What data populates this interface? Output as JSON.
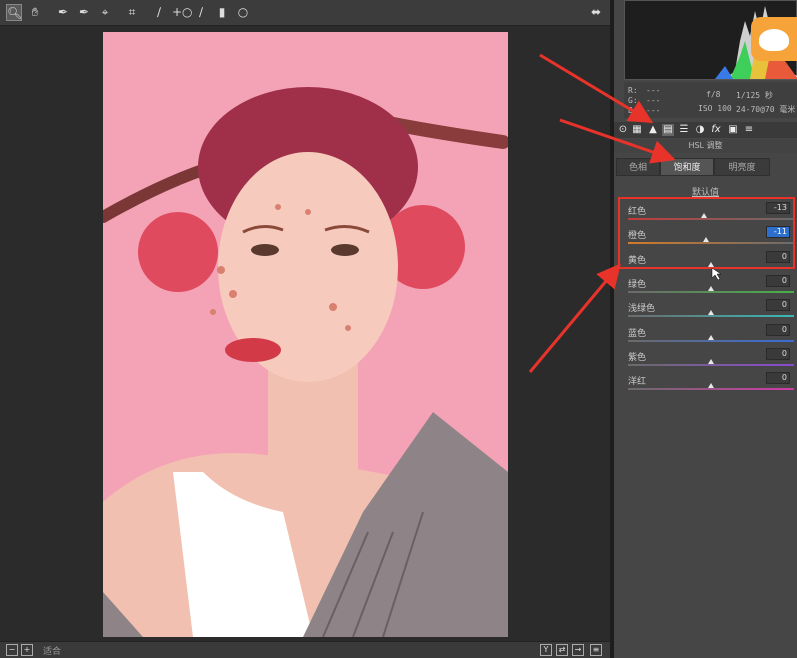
{
  "toolbar": {
    "tools": [
      "zoom-icon",
      "hand-icon",
      "eyedropper-icon",
      "color-sampler-icon",
      "target-adjust-icon",
      "crop-icon",
      "straighten-icon",
      "red-eye-icon",
      "brush-icon",
      "gradient-icon",
      "radial-icon"
    ],
    "export_icon": "export-icon"
  },
  "camera_info": {
    "r_label": "R:",
    "g_label": "G:",
    "b_label": "B:",
    "r_value": "---",
    "g_value": "---",
    "b_value": "---",
    "aperture": "f/8",
    "shutter": "1/125 秒",
    "iso": "ISO 100",
    "lens": "24-70@70 毫米"
  },
  "panel": {
    "title": "HSL 调整",
    "tabs": [
      "色相",
      "饱和度",
      "明亮度"
    ],
    "active_tab": 1,
    "default_link": "默认值",
    "sliders": [
      {
        "label": "红色",
        "value": "-13",
        "position": 0.46,
        "color_from": "#c23b3b",
        "color_to": "#6b6b6b"
      },
      {
        "label": "橙色",
        "value": "-11",
        "position": 0.47,
        "color_from": "#d27a2a",
        "color_to": "#6b6b6b"
      },
      {
        "label": "黄色",
        "value": "0",
        "position": 0.5,
        "color_from": "#6b6b6b",
        "color_to": "#d8c83a"
      },
      {
        "label": "绿色",
        "value": "0",
        "position": 0.5,
        "color_from": "#6b6b6b",
        "color_to": "#48b048"
      },
      {
        "label": "浅绿色",
        "value": "0",
        "position": 0.5,
        "color_from": "#6b6b6b",
        "color_to": "#3ab8b8"
      },
      {
        "label": "蓝色",
        "value": "0",
        "position": 0.5,
        "color_from": "#6b6b6b",
        "color_to": "#3a6bd8"
      },
      {
        "label": "紫色",
        "value": "0",
        "position": 0.5,
        "color_from": "#6b6b6b",
        "color_to": "#8a4ad0"
      },
      {
        "label": "洋红",
        "value": "0",
        "position": 0.5,
        "color_from": "#6b6b6b",
        "color_to": "#d03aa8"
      }
    ]
  },
  "statusbar": {
    "zoom_label": "适合"
  },
  "colors": {
    "annotation_red": "#e8332a",
    "highlight_blue": "#2d6fcf"
  }
}
